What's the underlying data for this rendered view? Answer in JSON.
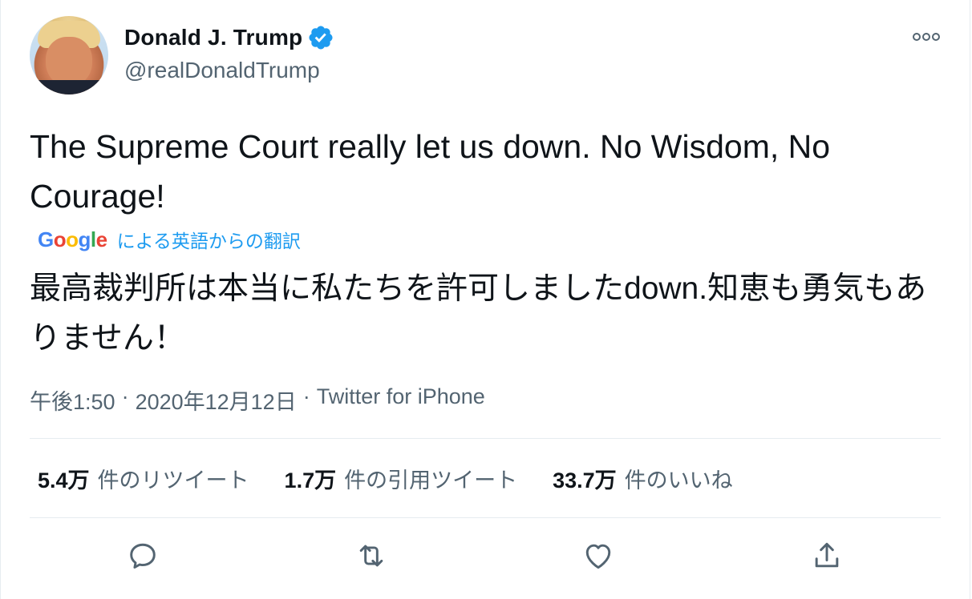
{
  "author": {
    "name": "Donald J. Trump",
    "handle": "@realDonaldTrump"
  },
  "tweet": {
    "text": "The Supreme Court really let us down. No Wisdom, No Courage!",
    "translation_label": "による英語からの翻訳",
    "translation_provider": "Google",
    "translated_text": "最高裁判所は本当に私たちを許可しましたdown.知恵も勇気もありません！",
    "time": "午後1:50",
    "separator": "·",
    "date": "2020年12月12日",
    "source": "Twitter for iPhone"
  },
  "stats": [
    {
      "count": "5.4万",
      "label": "件のリツイート"
    },
    {
      "count": "1.7万",
      "label": "件の引用ツイート"
    },
    {
      "count": "33.7万",
      "label": "件のいいね"
    }
  ],
  "icons": {
    "verified": "verified-badge-icon",
    "more": "more-options-icon",
    "reply": "reply-icon",
    "retweet": "retweet-icon",
    "like": "heart-icon",
    "share": "share-icon"
  },
  "colors": {
    "accent": "#1d9bf0",
    "text": "#0f1419",
    "secondary": "#536471",
    "divider": "#e6ecf0",
    "google_blue": "#4285F4",
    "google_red": "#EA4335",
    "google_yellow": "#FBBC05",
    "google_green": "#34A853"
  }
}
